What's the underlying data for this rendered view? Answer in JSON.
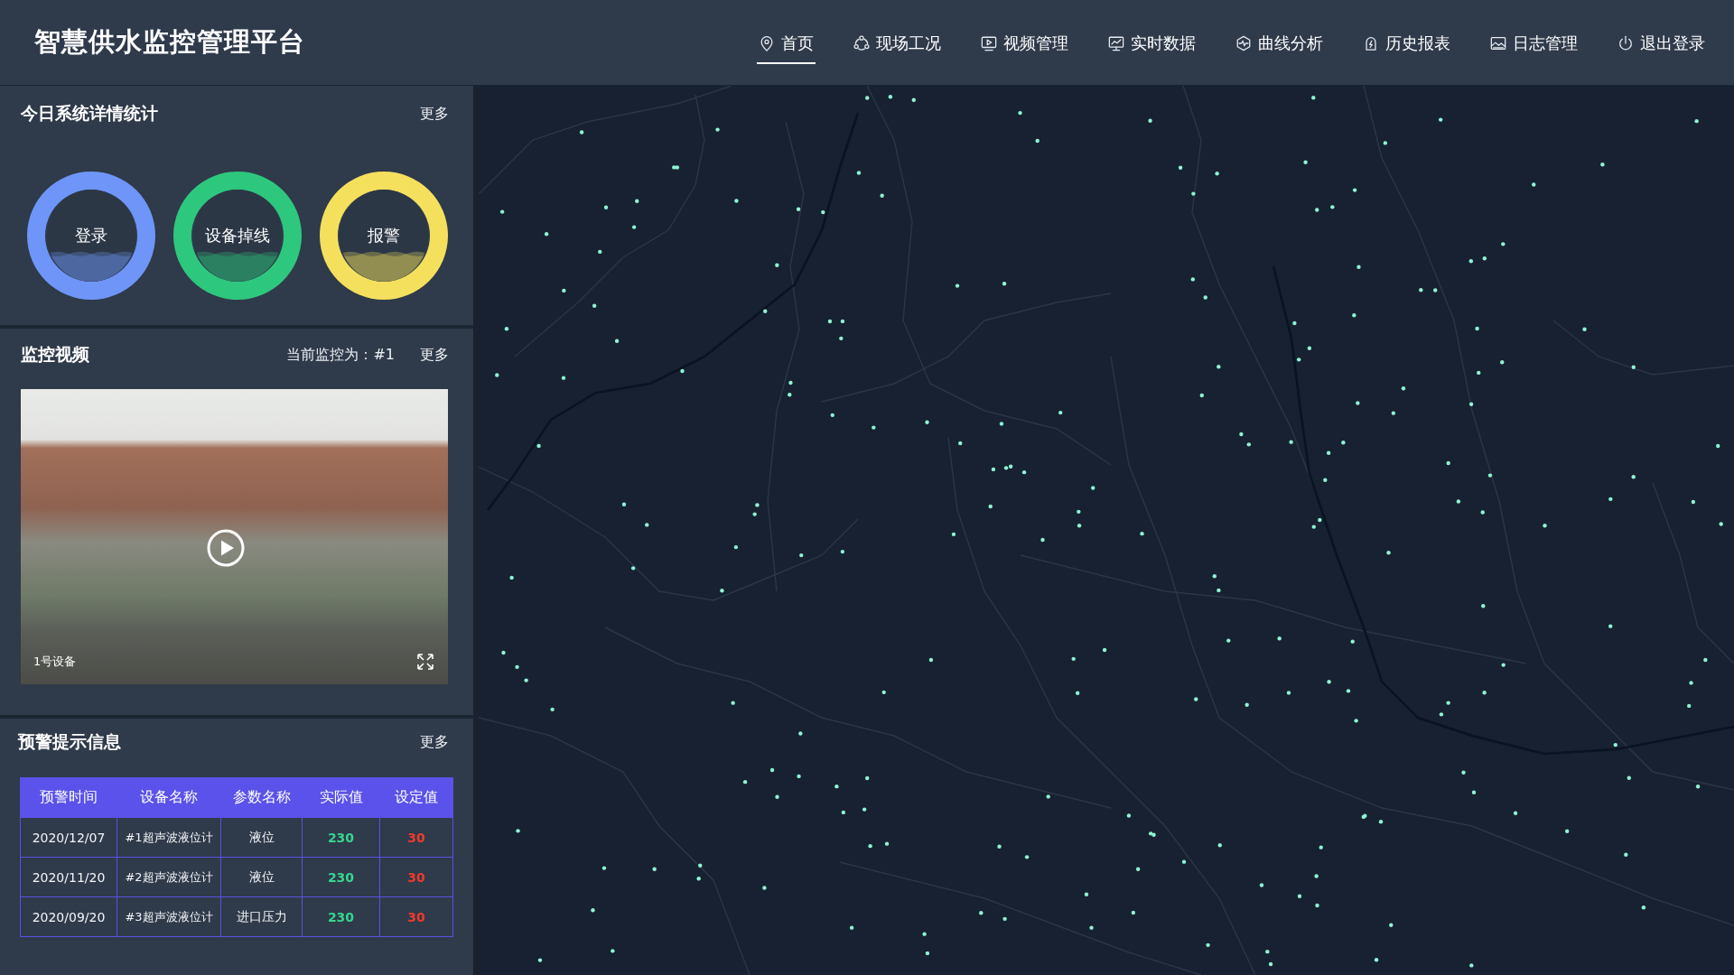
{
  "header": {
    "title": "智慧供水监控管理平台",
    "nav": [
      {
        "label": "首页",
        "selected": true
      },
      {
        "label": "现场工况",
        "selected": false
      },
      {
        "label": "视频管理",
        "selected": false
      },
      {
        "label": "实时数据",
        "selected": false
      },
      {
        "label": "曲线分析",
        "selected": false
      },
      {
        "label": "历史报表",
        "selected": false
      },
      {
        "label": "日志管理",
        "selected": false
      },
      {
        "label": "退出登录",
        "selected": false
      }
    ]
  },
  "stats_panel": {
    "title": "今日系统详情统计",
    "more": "更多",
    "gauges": [
      {
        "label": "登录",
        "color": "#6e95f7",
        "level": 0.35
      },
      {
        "label": "设备掉线",
        "color": "#2ec77e",
        "level": 0.35
      },
      {
        "label": "报警",
        "color": "#f5e05e",
        "level": 0.35
      }
    ]
  },
  "video_panel": {
    "title": "监控视频",
    "current": "当前监控为：#1",
    "more": "更多",
    "video": {
      "caption": "1号设备"
    }
  },
  "alert_panel": {
    "title": "预警提示信息",
    "more": "更多",
    "table": {
      "columns": [
        "预警时间",
        "设备名称",
        "参数名称",
        "实际值",
        "设定值"
      ],
      "rows": [
        [
          "2020/12/07",
          "#1超声波液位计",
          "液位",
          "230",
          "30"
        ],
        [
          "2020/11/20",
          "#2超声波液位计",
          "液位",
          "230",
          "30"
        ],
        [
          "2020/09/20",
          "#3超声波液位计",
          "进口压力",
          "230",
          "30"
        ]
      ]
    }
  }
}
